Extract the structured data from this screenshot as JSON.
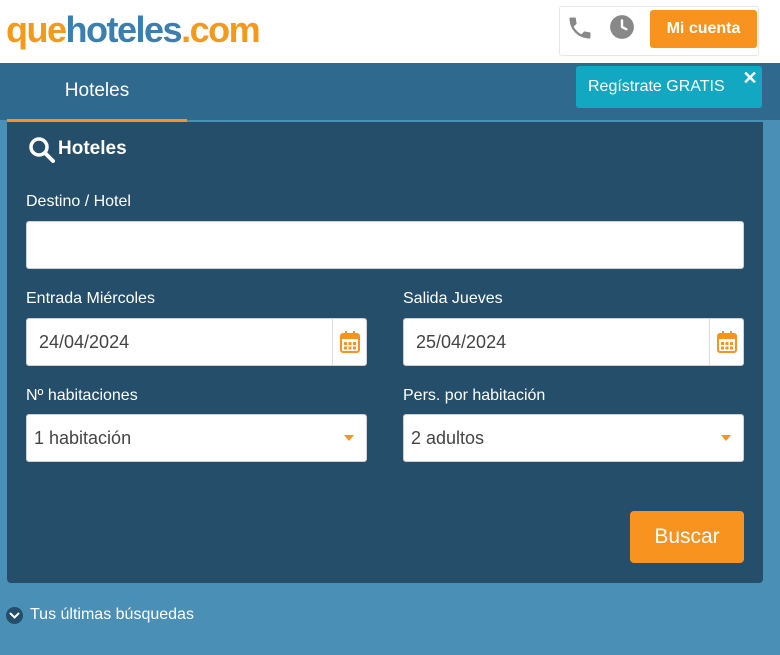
{
  "header": {
    "logo_part1": "que",
    "logo_part2": "hoteles",
    "logo_part3": ".com",
    "account_button": "Mi cuenta",
    "icons": [
      "phone-icon",
      "clock-icon"
    ]
  },
  "nav": {
    "active_tab": "Hoteles"
  },
  "tooltip": {
    "text": "Regístrate GRATIS",
    "close": "✕"
  },
  "search": {
    "title": "Hoteles",
    "destination_label": "Destino / Hotel",
    "destination_value": "",
    "checkin_label": "Entrada Miércoles",
    "checkin_value": "24/04/2024",
    "checkout_label": "Salida Jueves",
    "checkout_value": "25/04/2024",
    "rooms_label": "Nº habitaciones",
    "rooms_value": "1 habitación",
    "guests_label": "Pers. por habitación",
    "guests_value": "2 adultos",
    "submit": "Buscar"
  },
  "recent": {
    "label": "Tus últimas búsquedas"
  },
  "colors": {
    "accent": "#f7931e",
    "nav": "#2f6a8e",
    "panel": "#244e69",
    "page": "#4a8fb5",
    "tooltip": "#12a8c2"
  }
}
